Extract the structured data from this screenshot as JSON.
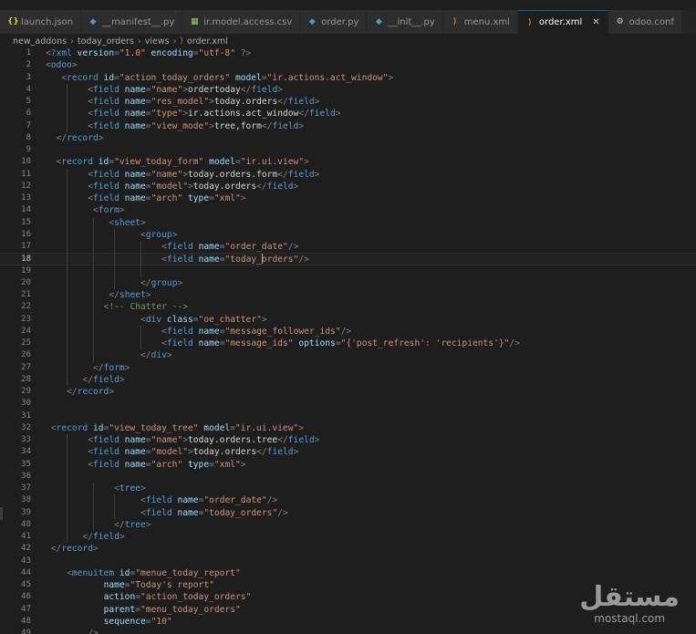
{
  "tabs": [
    {
      "label": "launch.json",
      "icon": "json-icon",
      "icon_text": "{}",
      "icon_color": "#cbcb41",
      "active": false,
      "name": "tab-launch-json"
    },
    {
      "label": "__manifest__.py",
      "icon": "python-icon",
      "icon_text": "◆",
      "icon_color": "#519aba",
      "active": false,
      "name": "tab-manifest-py"
    },
    {
      "label": "ir.model.access.csv",
      "icon": "csv-icon",
      "icon_text": "▦",
      "icon_color": "#89e051",
      "active": false,
      "name": "tab-ir-model-access-csv"
    },
    {
      "label": "order.py",
      "icon": "python-icon",
      "icon_text": "◆",
      "icon_color": "#519aba",
      "active": false,
      "name": "tab-order-py"
    },
    {
      "label": "__init__.py",
      "icon": "python-icon",
      "icon_text": "◆",
      "icon_color": "#519aba",
      "active": false,
      "name": "tab-init-py"
    },
    {
      "label": "menu.xml",
      "icon": "rss-icon",
      "icon_text": "⟩",
      "icon_color": "#e37933",
      "active": false,
      "name": "tab-menu-xml"
    },
    {
      "label": "order.xml",
      "icon": "rss-icon",
      "icon_text": "⟩",
      "icon_color": "#e37933",
      "active": true,
      "name": "tab-order-xml",
      "close": "✕"
    },
    {
      "label": "odoo.conf",
      "icon": "gear-icon",
      "icon_text": "⚙",
      "icon_color": "#cccccc",
      "active": false,
      "name": "tab-odoo-conf"
    }
  ],
  "breadcrumb": [
    "new_addons",
    "today_orders",
    "views",
    "order.xml"
  ],
  "breadcrumb_separator": "›",
  "current_line": 18,
  "code_lines": [
    {
      "n": "1",
      "indent": 0,
      "tokens": [
        [
          "pun",
          "<?"
        ],
        [
          "tag",
          "xml"
        ],
        [
          "attr",
          " version"
        ],
        [
          "pun",
          "="
        ],
        [
          "str",
          "\"1.0\""
        ],
        [
          "attr",
          " encoding"
        ],
        [
          "pun",
          "="
        ],
        [
          "str",
          "\"utf-8\""
        ],
        [
          "pun",
          " ?>"
        ]
      ]
    },
    {
      "n": "2",
      "indent": 0,
      "tokens": [
        [
          "pun",
          "<"
        ],
        [
          "tag",
          "odoo"
        ],
        [
          "pun",
          ">"
        ]
      ]
    },
    {
      "n": "3",
      "indent": 3,
      "tokens": [
        [
          "pun",
          "<"
        ],
        [
          "tag",
          "record"
        ],
        [
          "attr",
          " id"
        ],
        [
          "pun",
          "="
        ],
        [
          "str",
          "\"action_today_orders\""
        ],
        [
          "attr",
          " model"
        ],
        [
          "pun",
          "="
        ],
        [
          "str",
          "\"ir.actions.act_window\""
        ],
        [
          "pun",
          ">"
        ]
      ]
    },
    {
      "n": "4",
      "indent": 8,
      "tokens": [
        [
          "pun",
          "<"
        ],
        [
          "tag",
          "field"
        ],
        [
          "attr",
          " name"
        ],
        [
          "pun",
          "="
        ],
        [
          "str",
          "\"name\""
        ],
        [
          "pun",
          ">"
        ],
        [
          "text",
          "ordertoday"
        ],
        [
          "pun",
          "</"
        ],
        [
          "tag",
          "field"
        ],
        [
          "pun",
          ">"
        ]
      ]
    },
    {
      "n": "5",
      "indent": 8,
      "tokens": [
        [
          "pun",
          "<"
        ],
        [
          "tag",
          "field"
        ],
        [
          "attr",
          " name"
        ],
        [
          "pun",
          "="
        ],
        [
          "str",
          "\"res_model\""
        ],
        [
          "pun",
          ">"
        ],
        [
          "text",
          "today.orders"
        ],
        [
          "pun",
          "</"
        ],
        [
          "tag",
          "field"
        ],
        [
          "pun",
          ">"
        ]
      ]
    },
    {
      "n": "6",
      "indent": 8,
      "tokens": [
        [
          "pun",
          "<"
        ],
        [
          "tag",
          "field"
        ],
        [
          "attr",
          " name"
        ],
        [
          "pun",
          "="
        ],
        [
          "str",
          "\"type\""
        ],
        [
          "pun",
          ">"
        ],
        [
          "text",
          "ir.actions.act_window"
        ],
        [
          "pun",
          "</"
        ],
        [
          "tag",
          "field"
        ],
        [
          "pun",
          ">"
        ]
      ]
    },
    {
      "n": "7",
      "indent": 8,
      "tokens": [
        [
          "pun",
          "<"
        ],
        [
          "tag",
          "field"
        ],
        [
          "attr",
          " name"
        ],
        [
          "pun",
          "="
        ],
        [
          "str",
          "\"view_mode\""
        ],
        [
          "pun",
          ">"
        ],
        [
          "text",
          "tree,form"
        ],
        [
          "pun",
          "</"
        ],
        [
          "tag",
          "field"
        ],
        [
          "pun",
          ">"
        ]
      ]
    },
    {
      "n": "8",
      "indent": 2,
      "tokens": [
        [
          "pun",
          "</"
        ],
        [
          "tag",
          "record"
        ],
        [
          "pun",
          ">"
        ]
      ]
    },
    {
      "n": "9",
      "indent": 0,
      "tokens": []
    },
    {
      "n": "10",
      "indent": 2,
      "tokens": [
        [
          "pun",
          "<"
        ],
        [
          "tag",
          "record"
        ],
        [
          "attr",
          " id"
        ],
        [
          "pun",
          "="
        ],
        [
          "str",
          "\"view_today_form\""
        ],
        [
          "attr",
          " model"
        ],
        [
          "pun",
          "="
        ],
        [
          "str",
          "\"ir.ui.view\""
        ],
        [
          "pun",
          ">"
        ]
      ]
    },
    {
      "n": "11",
      "indent": 8,
      "tokens": [
        [
          "pun",
          "<"
        ],
        [
          "tag",
          "field"
        ],
        [
          "attr",
          " name"
        ],
        [
          "pun",
          "="
        ],
        [
          "str",
          "\"name\""
        ],
        [
          "pun",
          ">"
        ],
        [
          "text",
          "today.orders.form"
        ],
        [
          "pun",
          "</"
        ],
        [
          "tag",
          "field"
        ],
        [
          "pun",
          ">"
        ]
      ]
    },
    {
      "n": "12",
      "indent": 8,
      "tokens": [
        [
          "pun",
          "<"
        ],
        [
          "tag",
          "field"
        ],
        [
          "attr",
          " name"
        ],
        [
          "pun",
          "="
        ],
        [
          "str",
          "\"model\""
        ],
        [
          "pun",
          ">"
        ],
        [
          "text",
          "today.orders"
        ],
        [
          "pun",
          "</"
        ],
        [
          "tag",
          "field"
        ],
        [
          "pun",
          ">"
        ]
      ]
    },
    {
      "n": "13",
      "indent": 8,
      "tokens": [
        [
          "pun",
          "<"
        ],
        [
          "tag",
          "field"
        ],
        [
          "attr",
          " name"
        ],
        [
          "pun",
          "="
        ],
        [
          "str",
          "\"arch\""
        ],
        [
          "attr",
          " type"
        ],
        [
          "pun",
          "="
        ],
        [
          "str",
          "\"xml\""
        ],
        [
          "pun",
          ">"
        ]
      ]
    },
    {
      "n": "14",
      "indent": 9,
      "tokens": [
        [
          "pun",
          "<"
        ],
        [
          "tag",
          "form"
        ],
        [
          "pun",
          ">"
        ]
      ]
    },
    {
      "n": "15",
      "indent": 12,
      "tokens": [
        [
          "pun",
          "<"
        ],
        [
          "tag",
          "sheet"
        ],
        [
          "pun",
          ">"
        ]
      ]
    },
    {
      "n": "16",
      "indent": 18,
      "tokens": [
        [
          "pun",
          "<"
        ],
        [
          "tag",
          "group"
        ],
        [
          "pun",
          ">"
        ]
      ]
    },
    {
      "n": "17",
      "indent": 22,
      "tokens": [
        [
          "pun",
          "<"
        ],
        [
          "tag",
          "field"
        ],
        [
          "attr",
          " name"
        ],
        [
          "pun",
          "="
        ],
        [
          "str",
          "\"order_date\""
        ],
        [
          "pun",
          "/>"
        ]
      ]
    },
    {
      "n": "18",
      "indent": 22,
      "tokens": [
        [
          "pun",
          "<"
        ],
        [
          "tag",
          "field"
        ],
        [
          "attr",
          " name"
        ],
        [
          "pun",
          "="
        ],
        [
          "str",
          "\"today_orders\""
        ],
        [
          "pun",
          "/>"
        ]
      ]
    },
    {
      "n": "19",
      "indent": 0,
      "tokens": []
    },
    {
      "n": "20",
      "indent": 18,
      "tokens": [
        [
          "pun",
          "</"
        ],
        [
          "tag",
          "group"
        ],
        [
          "pun",
          ">"
        ]
      ]
    },
    {
      "n": "21",
      "indent": 12,
      "tokens": [
        [
          "pun",
          "</"
        ],
        [
          "tag",
          "sheet"
        ],
        [
          "pun",
          ">"
        ]
      ]
    },
    {
      "n": "22",
      "indent": 11,
      "tokens": [
        [
          "cmt",
          "<!-- Chatter -->"
        ]
      ]
    },
    {
      "n": "23",
      "indent": 18,
      "tokens": [
        [
          "pun",
          "<"
        ],
        [
          "tag",
          "div"
        ],
        [
          "attr",
          " class"
        ],
        [
          "pun",
          "="
        ],
        [
          "str",
          "\"oe_chatter\""
        ],
        [
          "pun",
          ">"
        ]
      ]
    },
    {
      "n": "24",
      "indent": 22,
      "tokens": [
        [
          "pun",
          "<"
        ],
        [
          "tag",
          "field"
        ],
        [
          "attr",
          " name"
        ],
        [
          "pun",
          "="
        ],
        [
          "str",
          "\"message_follower_ids\""
        ],
        [
          "pun",
          "/>"
        ]
      ]
    },
    {
      "n": "25",
      "indent": 22,
      "tokens": [
        [
          "pun",
          "<"
        ],
        [
          "tag",
          "field"
        ],
        [
          "attr",
          " name"
        ],
        [
          "pun",
          "="
        ],
        [
          "str",
          "\"message_ids\""
        ],
        [
          "attr",
          " options"
        ],
        [
          "pun",
          "="
        ],
        [
          "str",
          "\"{'post_refresh': 'recipients'}\""
        ],
        [
          "pun",
          "/>"
        ]
      ]
    },
    {
      "n": "26",
      "indent": 18,
      "tokens": [
        [
          "pun",
          "</"
        ],
        [
          "tag",
          "div"
        ],
        [
          "pun",
          ">"
        ]
      ]
    },
    {
      "n": "27",
      "indent": 9,
      "tokens": [
        [
          "pun",
          "</"
        ],
        [
          "tag",
          "form"
        ],
        [
          "pun",
          ">"
        ]
      ]
    },
    {
      "n": "28",
      "indent": 7,
      "tokens": [
        [
          "pun",
          "</"
        ],
        [
          "tag",
          "field"
        ],
        [
          "pun",
          ">"
        ]
      ]
    },
    {
      "n": "29",
      "indent": 4,
      "tokens": [
        [
          "pun",
          "</"
        ],
        [
          "tag",
          "record"
        ],
        [
          "pun",
          ">"
        ]
      ]
    },
    {
      "n": "30",
      "indent": 0,
      "tokens": []
    },
    {
      "n": "31",
      "indent": 0,
      "tokens": []
    },
    {
      "n": "32",
      "indent": 1,
      "tokens": [
        [
          "pun",
          "<"
        ],
        [
          "tag",
          "record"
        ],
        [
          "attr",
          " id"
        ],
        [
          "pun",
          "="
        ],
        [
          "str",
          "\"view_today_tree\""
        ],
        [
          "attr",
          " model"
        ],
        [
          "pun",
          "="
        ],
        [
          "str",
          "\"ir.ui.view\""
        ],
        [
          "pun",
          ">"
        ]
      ]
    },
    {
      "n": "33",
      "indent": 8,
      "tokens": [
        [
          "pun",
          "<"
        ],
        [
          "tag",
          "field"
        ],
        [
          "attr",
          " name"
        ],
        [
          "pun",
          "="
        ],
        [
          "str",
          "\"name\""
        ],
        [
          "pun",
          ">"
        ],
        [
          "text",
          "today.orders.tree"
        ],
        [
          "pun",
          "</"
        ],
        [
          "tag",
          "field"
        ],
        [
          "pun",
          ">"
        ]
      ]
    },
    {
      "n": "34",
      "indent": 8,
      "tokens": [
        [
          "pun",
          "<"
        ],
        [
          "tag",
          "field"
        ],
        [
          "attr",
          " name"
        ],
        [
          "pun",
          "="
        ],
        [
          "str",
          "\"model\""
        ],
        [
          "pun",
          ">"
        ],
        [
          "text",
          "today.orders"
        ],
        [
          "pun",
          "</"
        ],
        [
          "tag",
          "field"
        ],
        [
          "pun",
          ">"
        ]
      ]
    },
    {
      "n": "35",
      "indent": 8,
      "tokens": [
        [
          "pun",
          "<"
        ],
        [
          "tag",
          "field"
        ],
        [
          "attr",
          " name"
        ],
        [
          "pun",
          "="
        ],
        [
          "str",
          "\"arch\""
        ],
        [
          "attr",
          " type"
        ],
        [
          "pun",
          "="
        ],
        [
          "str",
          "\"xml\""
        ],
        [
          "pun",
          ">"
        ]
      ]
    },
    {
      "n": "36",
      "indent": 0,
      "tokens": []
    },
    {
      "n": "37",
      "indent": 13,
      "tokens": [
        [
          "pun",
          "<"
        ],
        [
          "tag",
          "tree"
        ],
        [
          "pun",
          ">"
        ]
      ]
    },
    {
      "n": "38",
      "indent": 18,
      "tokens": [
        [
          "pun",
          "<"
        ],
        [
          "tag",
          "field"
        ],
        [
          "attr",
          " name"
        ],
        [
          "pun",
          "="
        ],
        [
          "str",
          "\"order_date\""
        ],
        [
          "pun",
          "/>"
        ]
      ]
    },
    {
      "n": "39",
      "indent": 18,
      "tokens": [
        [
          "pun",
          "<"
        ],
        [
          "tag",
          "field"
        ],
        [
          "attr",
          " name"
        ],
        [
          "pun",
          "="
        ],
        [
          "str",
          "\"today_orders\""
        ],
        [
          "pun",
          "/>"
        ]
      ]
    },
    {
      "n": "40",
      "indent": 13,
      "tokens": [
        [
          "pun",
          "</"
        ],
        [
          "tag",
          "tree"
        ],
        [
          "pun",
          ">"
        ]
      ]
    },
    {
      "n": "41",
      "indent": 7,
      "tokens": [
        [
          "pun",
          "</"
        ],
        [
          "tag",
          "field"
        ],
        [
          "pun",
          ">"
        ]
      ]
    },
    {
      "n": "42",
      "indent": 1,
      "tokens": [
        [
          "pun",
          "</"
        ],
        [
          "tag",
          "record"
        ],
        [
          "pun",
          ">"
        ]
      ]
    },
    {
      "n": "43",
      "indent": 0,
      "tokens": []
    },
    {
      "n": "44",
      "indent": 4,
      "tokens": [
        [
          "pun",
          "<"
        ],
        [
          "tag",
          "menuitem"
        ],
        [
          "attr",
          " id"
        ],
        [
          "pun",
          "="
        ],
        [
          "str",
          "\"menue_today_report\""
        ]
      ]
    },
    {
      "n": "45",
      "indent": 11,
      "tokens": [
        [
          "attr",
          "name"
        ],
        [
          "pun",
          "="
        ],
        [
          "str",
          "\"Today's report\""
        ]
      ]
    },
    {
      "n": "46",
      "indent": 11,
      "tokens": [
        [
          "attr",
          "action"
        ],
        [
          "pun",
          "="
        ],
        [
          "str",
          "\"action_today_orders\""
        ]
      ]
    },
    {
      "n": "47",
      "indent": 11,
      "tokens": [
        [
          "attr",
          "parent"
        ],
        [
          "pun",
          "="
        ],
        [
          "str",
          "\"menu_today_orders\""
        ]
      ]
    },
    {
      "n": "48",
      "indent": 11,
      "tokens": [
        [
          "attr",
          "sequence"
        ],
        [
          "pun",
          "="
        ],
        [
          "str",
          "\"10\""
        ]
      ]
    },
    {
      "n": "49",
      "indent": 8,
      "tokens": [
        [
          "pun",
          "/>"
        ]
      ]
    }
  ],
  "watermark": {
    "arabic": "مستقل",
    "latin": "mostaql.com"
  }
}
